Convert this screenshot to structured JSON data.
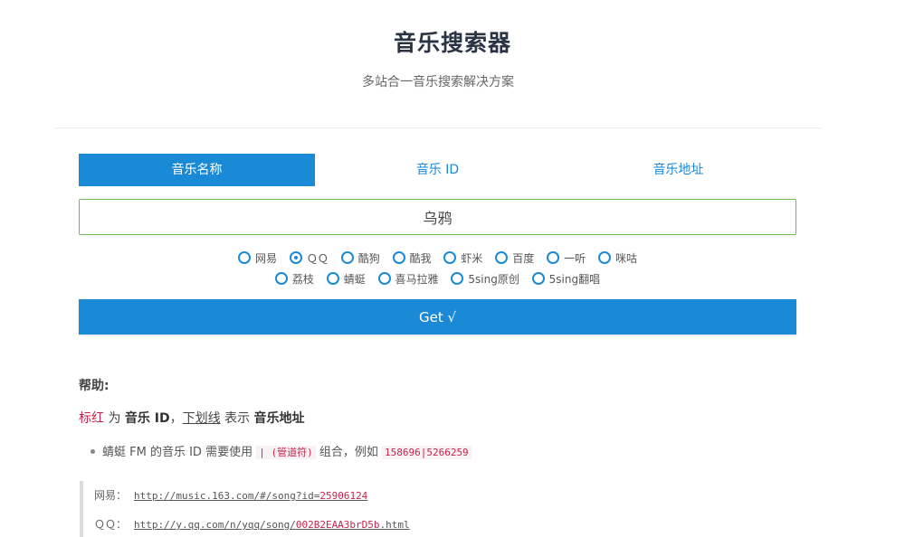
{
  "header": {
    "title": "音乐搜索器",
    "subtitle": "多站合一音乐搜索解决方案"
  },
  "tabs": [
    {
      "label": "音乐名称",
      "active": true
    },
    {
      "label": "音乐 ID",
      "active": false
    },
    {
      "label": "音乐地址",
      "active": false
    }
  ],
  "search": {
    "value": "乌鸦"
  },
  "sources": {
    "row1": [
      "网易",
      "ＱＱ",
      "酷狗",
      "酷我",
      "虾米",
      "百度",
      "一听",
      "咪咕"
    ],
    "row2": [
      "荔枝",
      "蜻蜓",
      "喜马拉雅",
      "5sing原创",
      "5sing翻唱"
    ],
    "selected": "ＱＱ"
  },
  "get_button": {
    "label": "Get √"
  },
  "help": {
    "title": "帮助:",
    "legend": {
      "red_word": "标红",
      "part1": " 为 ",
      "bold1": "音乐 ID",
      "sep": "，",
      "underline_word": "下划线",
      "part2": " 表示 ",
      "bold2": "音乐地址"
    },
    "bullet": {
      "text1": "蜻蜓 FM 的音乐 ID 需要使用 ",
      "code1": "| (管道符)",
      "text2": " 组合，例如 ",
      "code2": "158696|5266259"
    },
    "examples": [
      {
        "label": "网易：",
        "url_prefix": "http://music.163.com/#/song?id=",
        "id": "25906124",
        "url_suffix": ""
      },
      {
        "label": "ＱＱ：",
        "url_prefix": "http://y.qq.com/n/yqq/song/",
        "id": "002B2EAA3brD5b",
        "url_suffix": ".html"
      }
    ]
  },
  "colors": {
    "primary": "#1a8ad6",
    "input_border": "#70bb55",
    "highlight_red": "#c7254e"
  }
}
